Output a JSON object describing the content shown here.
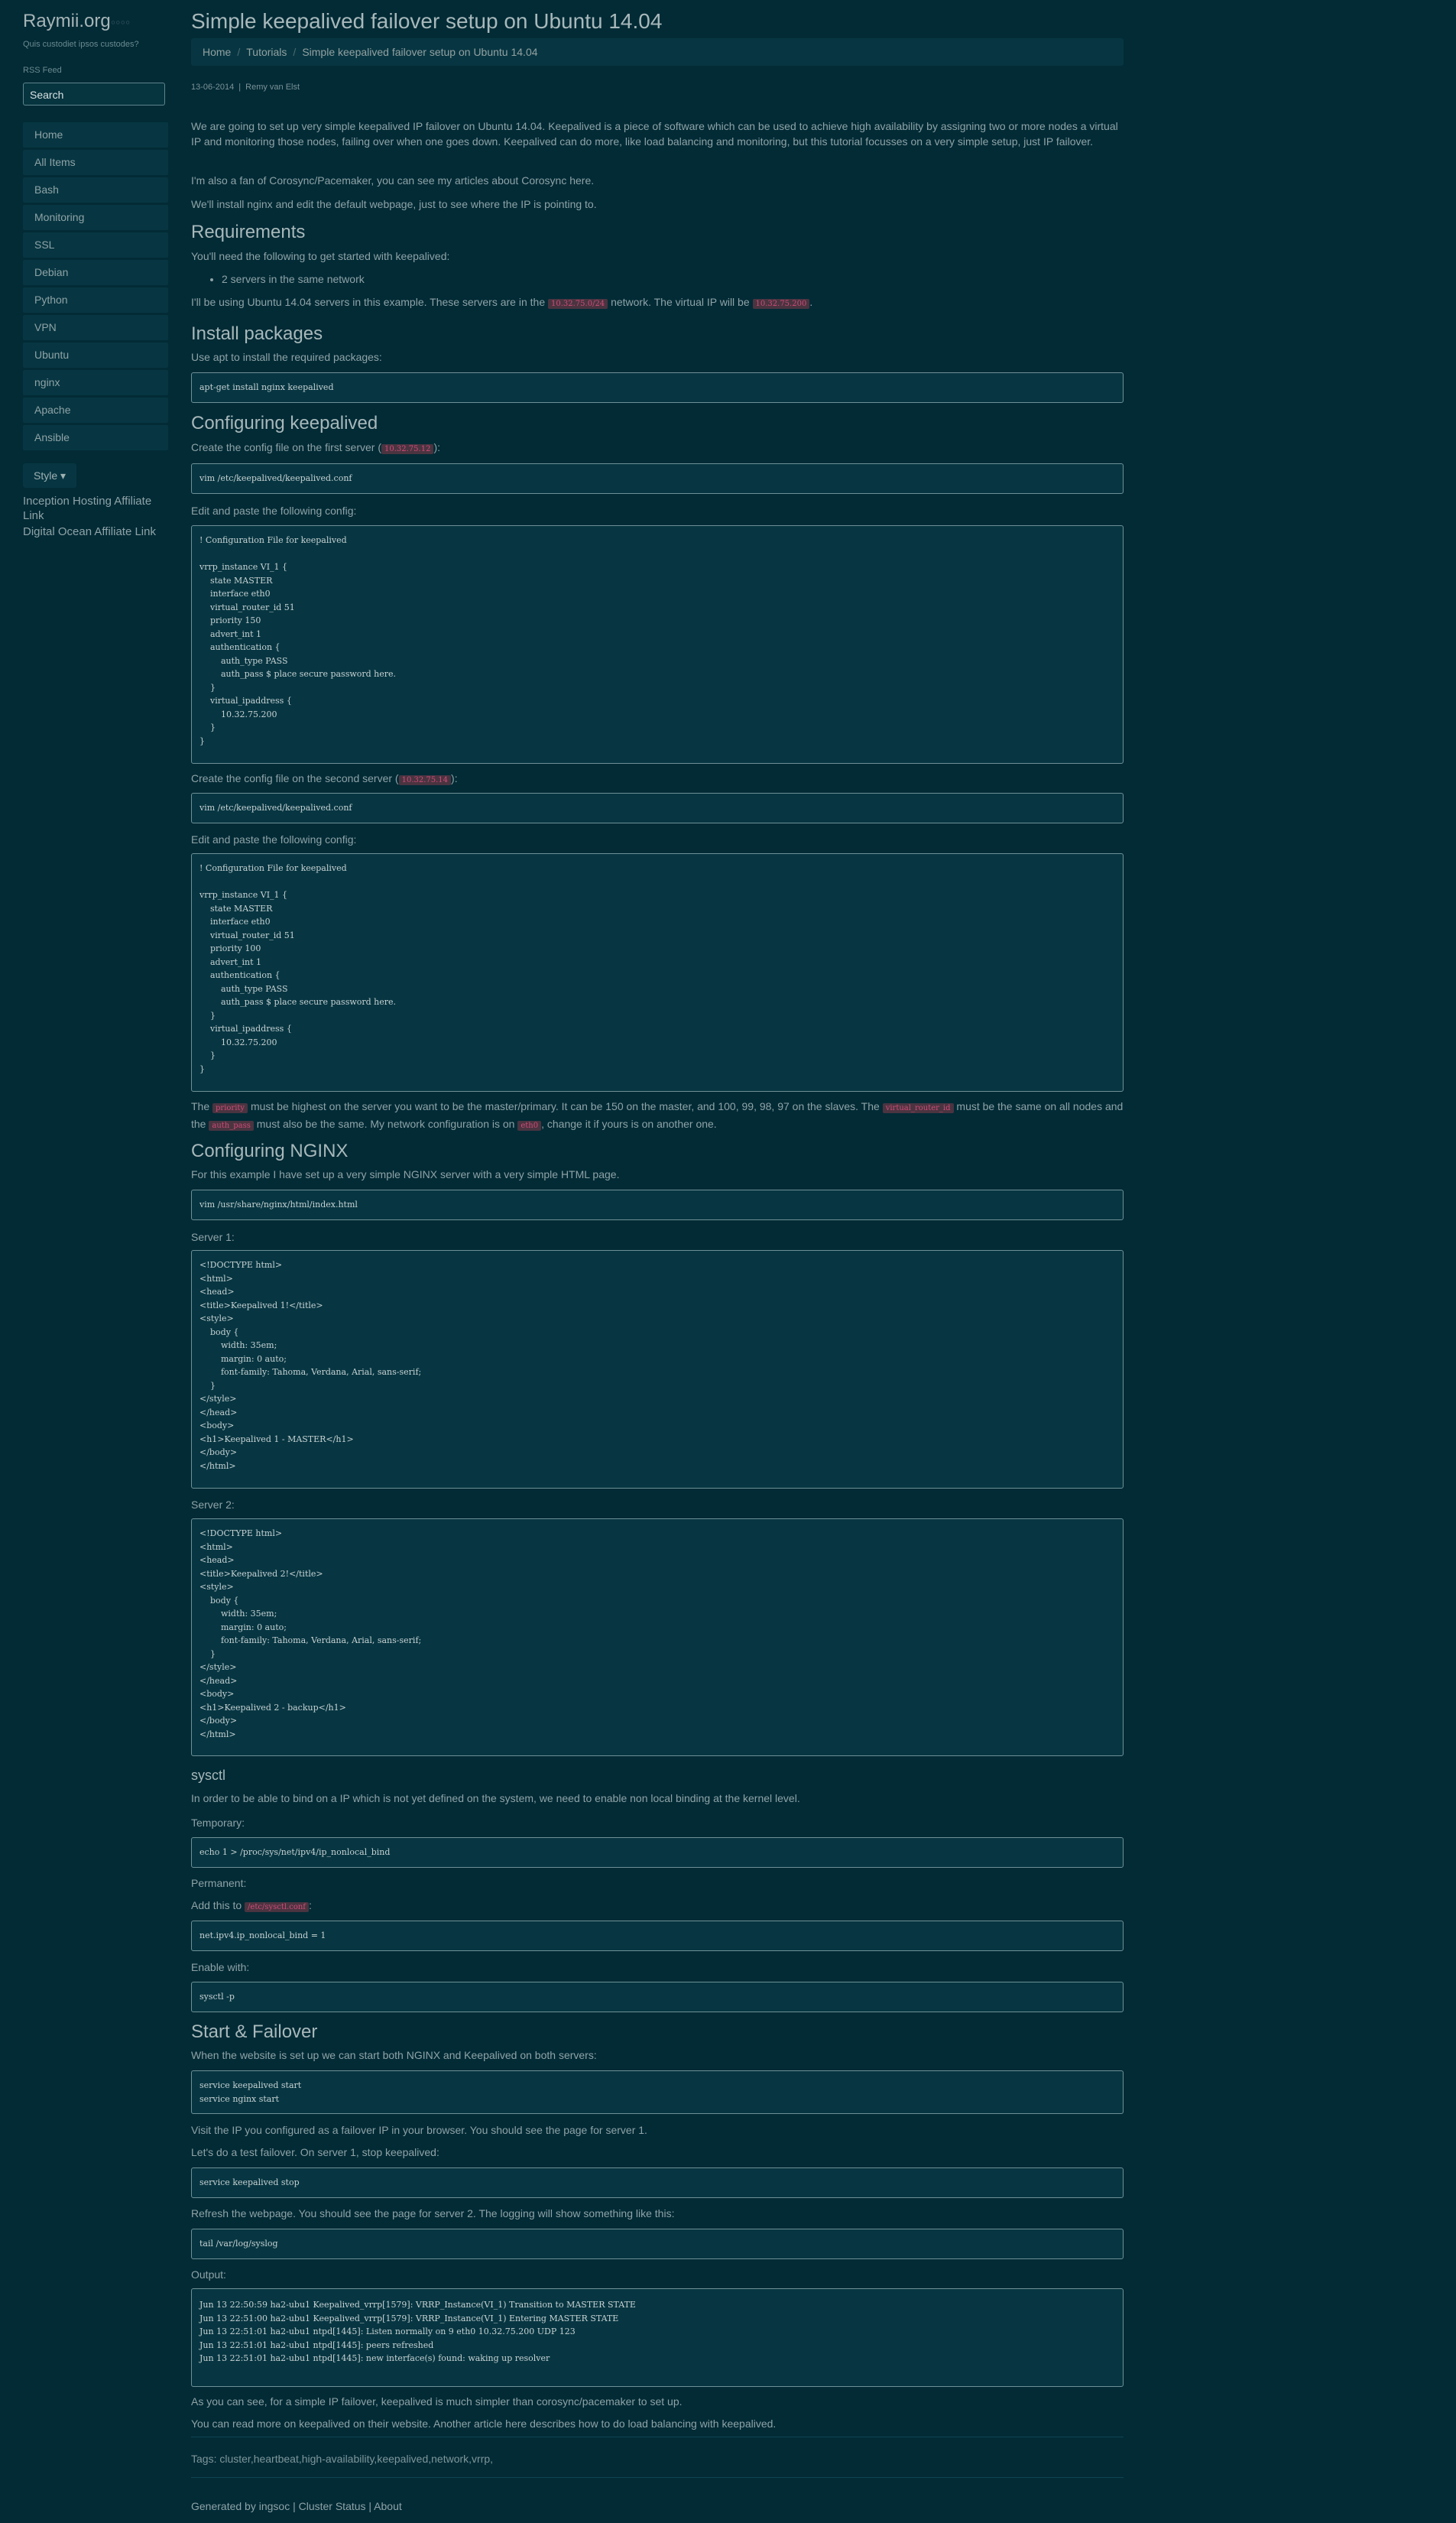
{
  "sidebar": {
    "site_title": "Raymii.org",
    "tagline": "Quis custodiet ipsos custodes?",
    "rss": "RSS Feed",
    "search_placeholder": "Search",
    "nav": [
      "Home",
      "All Items",
      "Bash",
      "Monitoring",
      "SSL",
      "Debian",
      "Python",
      "VPN",
      "Ubuntu",
      "nginx",
      "Apache",
      "Ansible"
    ],
    "style_label": "Style ▾",
    "affiliate1": "Inception Hosting Affiliate Link",
    "affiliate2": "Digital Ocean Affiliate Link"
  },
  "article": {
    "title": "Simple keepalived failover setup on Ubuntu 14.04",
    "breadcrumb": [
      "Home",
      "Tutorials",
      "Simple keepalived failover setup on Ubuntu 14.04"
    ],
    "date": "13-06-2014",
    "author": "Remy van Elst",
    "intro1": "We are going to set up very simple keepalived IP failover on Ubuntu 14.04. Keepalived is a piece of software which can be used to achieve high availability by assigning two or more nodes a virtual IP and monitoring those nodes, failing over when one goes down. Keepalived can do more, like load balancing and monitoring, but this tutorial focusses on a very simple setup, just IP failover.",
    "intro2": "I'm also a fan of Corosync/Pacemaker, you can see my articles about Corosync here.",
    "intro3": "We'll install nginx and edit the default webpage, just to see where the IP is pointing to.",
    "h_requirements": "Requirements",
    "req_text": "You'll need the following to get started with keepalived:",
    "req_item": "2 servers in the same network",
    "req_note_a": "I'll be using Ubuntu 14.04 servers in this example. These servers are in the",
    "req_note_code1": "10.32.75.0/24",
    "req_note_b": "network. The virtual IP will be",
    "req_note_code2": "10.32.75.200",
    "req_note_c": ".",
    "h_install": "Install packages",
    "install_text": "Use apt to install the required packages:",
    "install_code": "apt-get install nginx keepalived",
    "h_config": "Configuring keepalived",
    "cfg1_a": "Create the config file on the first server (",
    "cfg1_code": "10.32.75.12",
    "cfg1_b": "):",
    "cfg1_cmd": "vim /etc/keepalived/keepalived.conf",
    "edit1": "Edit and paste the following config:",
    "conf1": "! Configuration File for keepalived\n\nvrrp_instance VI_1 {\n    state MASTER\n    interface eth0\n    virtual_router_id 51\n    priority 150\n    advert_int 1\n    authentication {\n        auth_type PASS\n        auth_pass $ place secure password here.\n    }\n    virtual_ipaddress {\n        10.32.75.200\n    }\n}",
    "cfg2_a": "Create the config file on the second server (",
    "cfg2_code": "10.32.75.14",
    "cfg2_b": "):",
    "cfg2_cmd": "vim /etc/keepalived/keepalived.conf",
    "edit2": "Edit and paste the following config:",
    "conf2": "! Configuration File for keepalived\n\nvrrp_instance VI_1 {\n    state MASTER\n    interface eth0\n    virtual_router_id 51\n    priority 100\n    advert_int 1\n    authentication {\n        auth_type PASS\n        auth_pass $ place secure password here.\n    }\n    virtual_ipaddress {\n        10.32.75.200\n    }\n}",
    "prio_a": "The",
    "prio_code1": "priority",
    "prio_b": "must be highest on the server you want to be the master/primary. It can be 150 on the master, and 100, 99, 98, 97 on the slaves. The",
    "prio_code2": "virtual_router_id",
    "prio_c": "must be the same on all nodes and the",
    "prio_code3": "auth_pass",
    "prio_d": "must also be the same. My network configuration is on",
    "prio_code4": "eth0",
    "prio_e": ", change it if yours is on another one.",
    "h_nginx": "Configuring NGINX",
    "nginx_text": "For this example I have set up a very simple NGINX server with a very simple HTML page.",
    "nginx_cmd": "vim /usr/share/nginx/html/index.html",
    "server1": "Server 1:",
    "html1": "<!DOCTYPE html>\n<html>\n<head>\n<title>Keepalived 1!</title>\n<style>\n    body {\n        width: 35em;\n        margin: 0 auto;\n        font-family: Tahoma, Verdana, Arial, sans-serif;\n    }\n</style>\n</head>\n<body>\n<h1>Keepalived 1 - MASTER</h1>\n</body>\n</html>",
    "server2": "Server 2:",
    "html2": "<!DOCTYPE html>\n<html>\n<head>\n<title>Keepalived 2!</title>\n<style>\n    body {\n        width: 35em;\n        margin: 0 auto;\n        font-family: Tahoma, Verdana, Arial, sans-serif;\n    }\n</style>\n</head>\n<body>\n<h1>Keepalived 2 - backup</h1>\n</body>\n</html>",
    "h_sysctl": "sysctl",
    "sysctl_text": "In order to be able to bind on a IP which is not yet defined on the system, we need to enable non local binding at the kernel level.",
    "temporary": "Temporary:",
    "temp_cmd": "echo 1 > /proc/sys/net/ipv4/ip_nonlocal_bind",
    "permanent": "Permanent:",
    "add_a": "Add this to",
    "add_code": "/etc/sysctl.conf",
    "add_b": ":",
    "perm_cmd": "net.ipv4.ip_nonlocal_bind = 1",
    "enable": "Enable with:",
    "enable_cmd": "sysctl -p",
    "h_start": "Start & Failover",
    "start_text": "When the website is set up we can start both NGINX and Keepalived on both servers:",
    "start_cmd": "service keepalived start\nservice nginx start",
    "visit": "Visit the IP you configured as a failover IP in your browser. You should see the page for server 1.",
    "test": "Let's do a test failover. On server 1, stop keepalived:",
    "stop_cmd": "service keepalived stop",
    "refresh": "Refresh the webpage. You should see the page for server 2. The logging will show something like this:",
    "tail_cmd": "tail /var/log/syslog",
    "output": "Output:",
    "log": "Jun 13 22:50:59 ha2-ubu1 Keepalived_vrrp[1579]: VRRP_Instance(VI_1) Transition to MASTER STATE\nJun 13 22:51:00 ha2-ubu1 Keepalived_vrrp[1579]: VRRP_Instance(VI_1) Entering MASTER STATE\nJun 13 22:51:01 ha2-ubu1 ntpd[1445]: Listen normally on 9 eth0 10.32.75.200 UDP 123\nJun 13 22:51:01 ha2-ubu1 ntpd[1445]: peers refreshed\nJun 13 22:51:01 ha2-ubu1 ntpd[1445]: new interface(s) found: waking up resolver",
    "conclusion1": "As you can see, for a simple IP failover, keepalived is much simpler than corosync/pacemaker to set up.",
    "conclusion2": "You can read more on keepalived on their website. Another article here describes how to do load balancing with keepalived.",
    "tags": "Tags: cluster,heartbeat,high-availability,keepalived,network,vrrp,",
    "footer": "Generated by ingsoc | Cluster Status | About"
  }
}
